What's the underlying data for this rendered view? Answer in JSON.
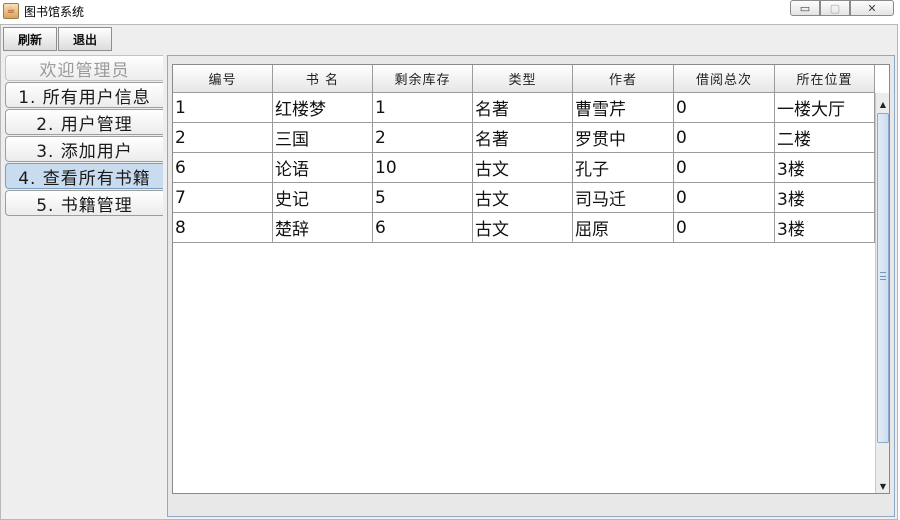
{
  "window": {
    "title": "图书馆系统",
    "controls": {
      "minimize": "▭",
      "maximize": "▢",
      "close": "✕"
    }
  },
  "toolbar": {
    "refresh_label": "刷新",
    "exit_label": "退出"
  },
  "nav": {
    "items": [
      {
        "label": "欢迎管理员",
        "state": "disabled"
      },
      {
        "label": "1. 所有用户信息",
        "state": "normal"
      },
      {
        "label": "2. 用户管理",
        "state": "normal"
      },
      {
        "label": "3. 添加用户",
        "state": "normal"
      },
      {
        "label": "4. 查看所有书籍",
        "state": "active"
      },
      {
        "label": "5. 书籍管理",
        "state": "normal"
      }
    ]
  },
  "table": {
    "columns": [
      "编号",
      "书 名",
      "剩余库存",
      "类型",
      "作者",
      "借阅总次",
      "所在位置"
    ],
    "rows": [
      [
        "1",
        "红楼梦",
        "1",
        "名著",
        "曹雪芹",
        "0",
        "一楼大厅"
      ],
      [
        "2",
        "三国",
        "2",
        "名著",
        "罗贯中",
        "0",
        "二楼"
      ],
      [
        "6",
        "论语",
        "10",
        "古文",
        "孔子",
        "0",
        "3楼"
      ],
      [
        "7",
        "史记",
        "5",
        "古文",
        "司马迁",
        "0",
        "3楼"
      ],
      [
        "8",
        "楚辞",
        "6",
        "古文",
        "屈原",
        "0",
        "3楼"
      ]
    ]
  },
  "colors": {
    "active_tab": "#c9dcef",
    "frame_bg": "#eeeeee",
    "grid_line": "#9c9c9c"
  }
}
